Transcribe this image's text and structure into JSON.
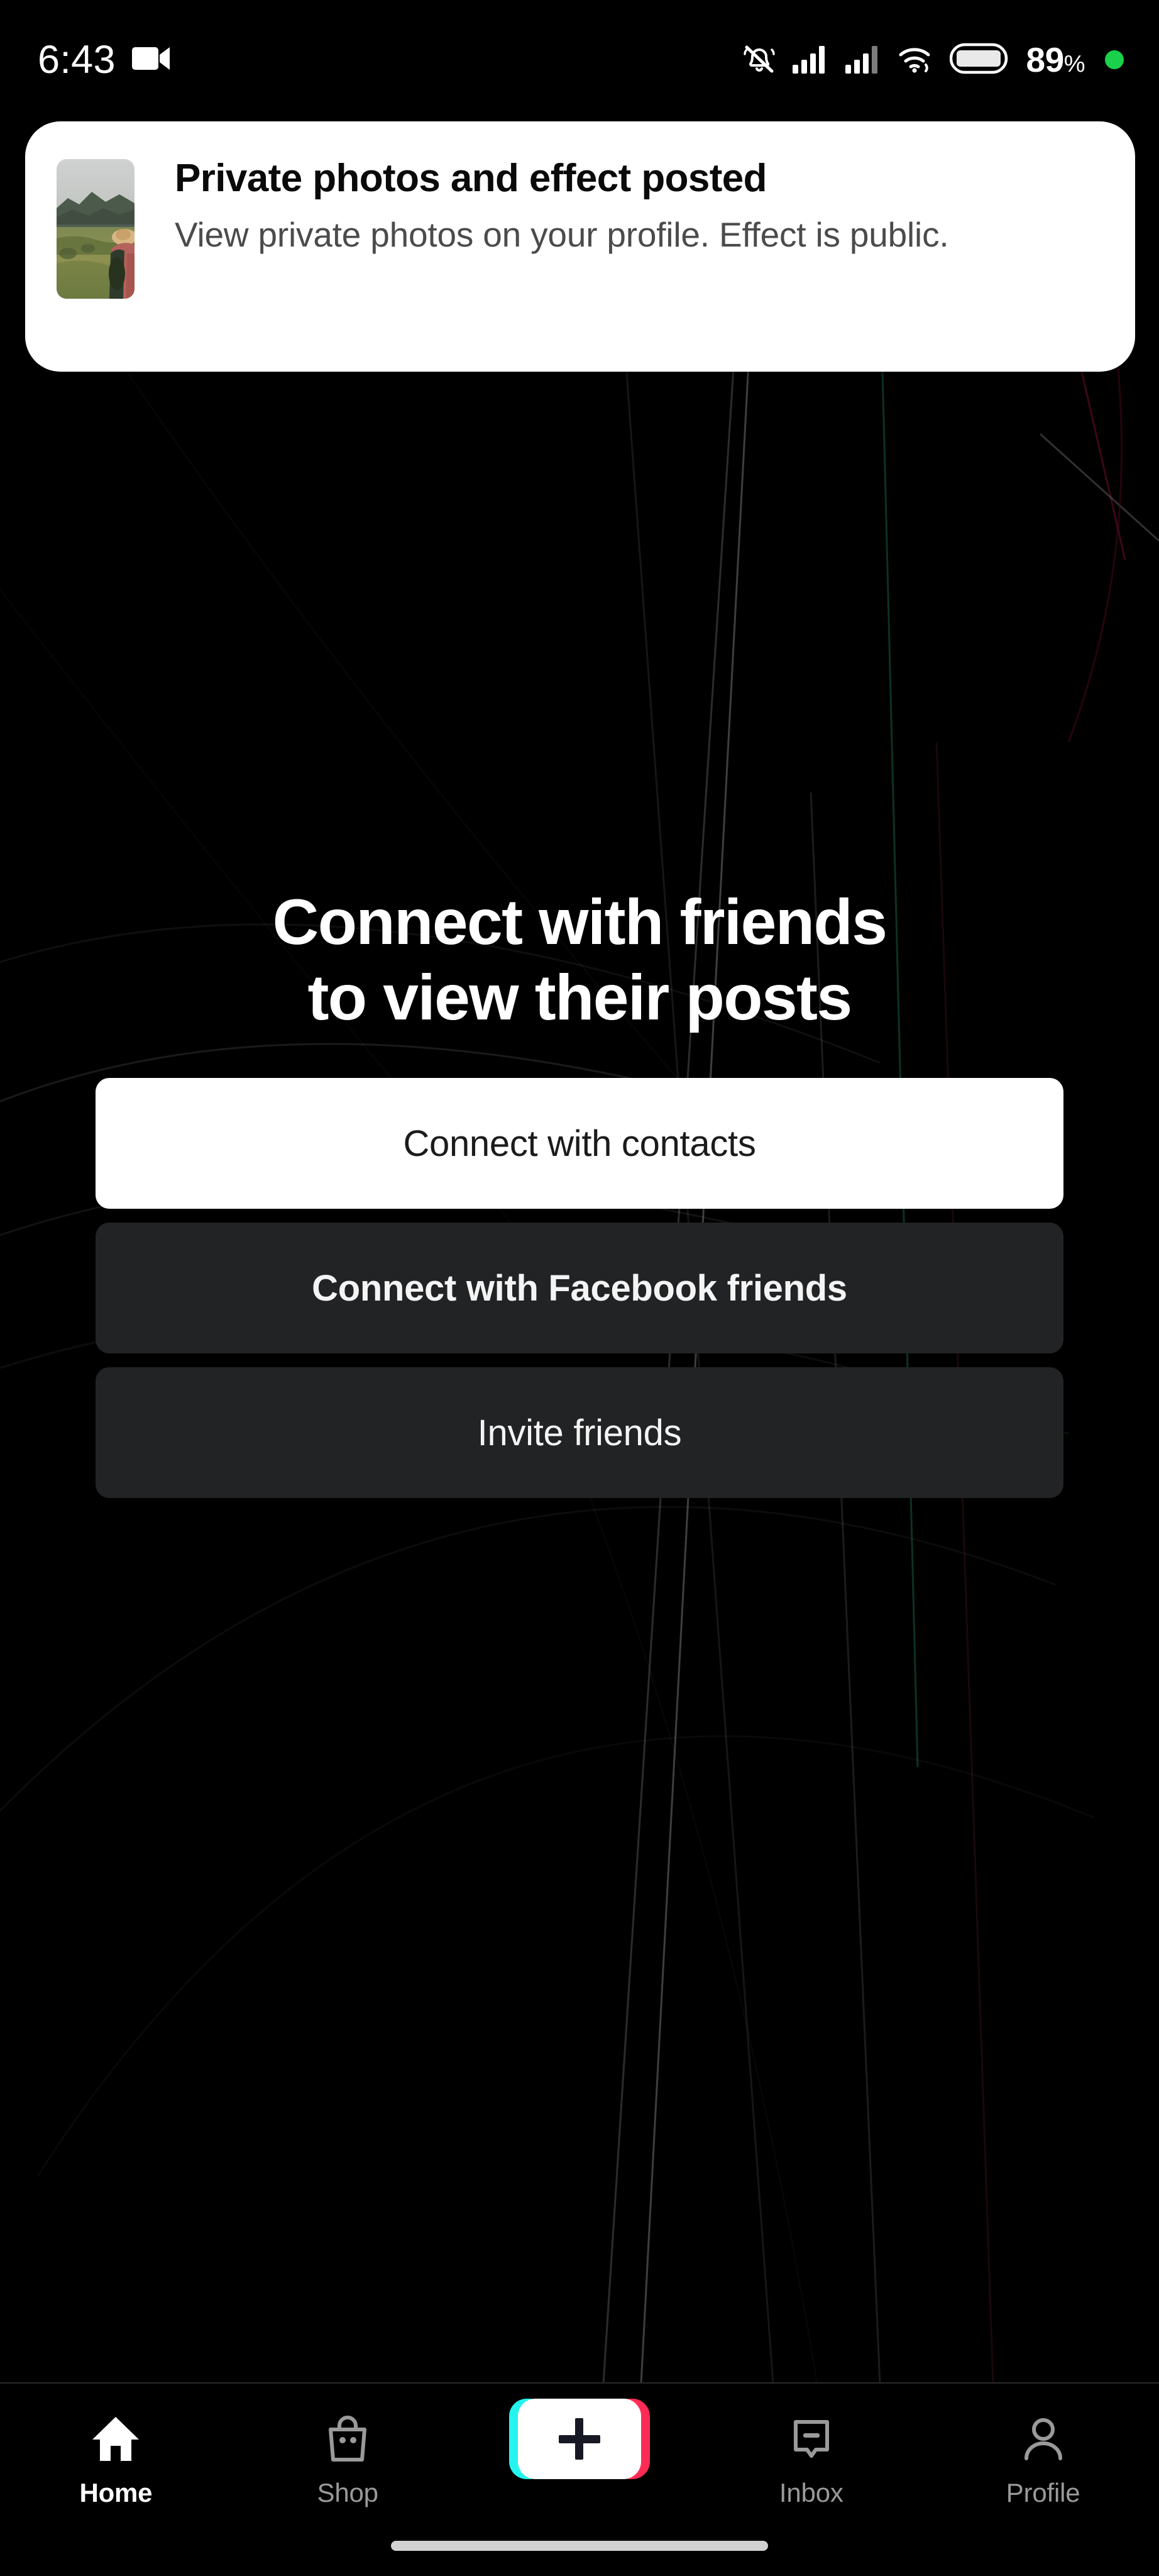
{
  "status_bar": {
    "time": "6:43",
    "battery_percent": "89",
    "percent_symbol": "%",
    "icons": [
      "video-camera-icon",
      "bell-muted-icon",
      "signal-bars-icon",
      "signal-bars-2-icon",
      "wifi-icon",
      "battery-icon",
      "recording-dot-icon"
    ]
  },
  "notification": {
    "title": "Private photos and effect posted",
    "body": "View private photos on your profile. Effect is public.",
    "thumbnail_alt": "landscape-photo-person-with-hat"
  },
  "empty_state": {
    "heading": "Connect with friends\nto view their posts",
    "buttons": [
      {
        "label": "Connect with contacts",
        "style": "primary"
      },
      {
        "label": "Connect with Facebook friends",
        "style": "secondary-bold"
      },
      {
        "label": "Invite friends",
        "style": "secondary"
      }
    ]
  },
  "bottom_nav": {
    "items": [
      {
        "label": "Home",
        "icon": "home-icon",
        "active": true
      },
      {
        "label": "Shop",
        "icon": "shopping-bag-icon",
        "active": false
      },
      {
        "label": "",
        "icon": "create-plus-icon",
        "active": false
      },
      {
        "label": "Inbox",
        "icon": "message-icon",
        "active": false
      },
      {
        "label": "Profile",
        "icon": "person-icon",
        "active": false
      }
    ]
  },
  "colors": {
    "background": "#000000",
    "card": "#ffffff",
    "secondary_button": "#222325",
    "accent_cyan": "#25f4ee",
    "accent_pink": "#fe2c55",
    "inactive_icon": "#9a9a9a",
    "status_green": "#19d14a"
  }
}
